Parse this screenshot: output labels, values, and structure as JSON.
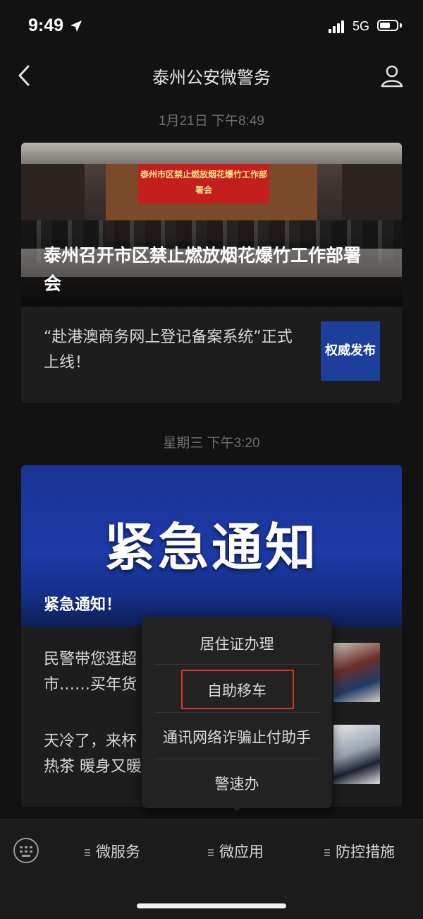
{
  "status_bar": {
    "time": "9:49",
    "network": "5G"
  },
  "header": {
    "title": "泰州公安微警务"
  },
  "feed": [
    {
      "timestamp": "1月21日 下午8:49",
      "headline": "泰州召开市区禁止燃放烟花爆竹工作部署会",
      "banner_text": "泰州市区禁止燃放烟花爆竹工作部署会",
      "items": [
        {
          "text": "“赴港澳商务网上登记备案系统”正式上线！",
          "thumb_label": "权威发布"
        }
      ]
    },
    {
      "timestamp": "星期三 下午3:20",
      "hero_big_text": "紧急通知",
      "headline": "紧急通知！",
      "items": [
        {
          "text": "民警带您逛超市……买年货 平安回家"
        },
        {
          "text": "天冷了，来杯热茶 暖身又暖心！"
        }
      ]
    }
  ],
  "popup_menu": {
    "items": [
      "居住证办理",
      "自助移车",
      "通讯网络诈骗止付助手",
      "警速办"
    ],
    "highlighted": "自助移车"
  },
  "bottom_menu": {
    "tabs": [
      "微服务",
      "微应用",
      "防控措施"
    ]
  },
  "colors": {
    "accent_blue": "#1b3f9a",
    "highlight_red": "#d8342c",
    "background": "#121212"
  }
}
